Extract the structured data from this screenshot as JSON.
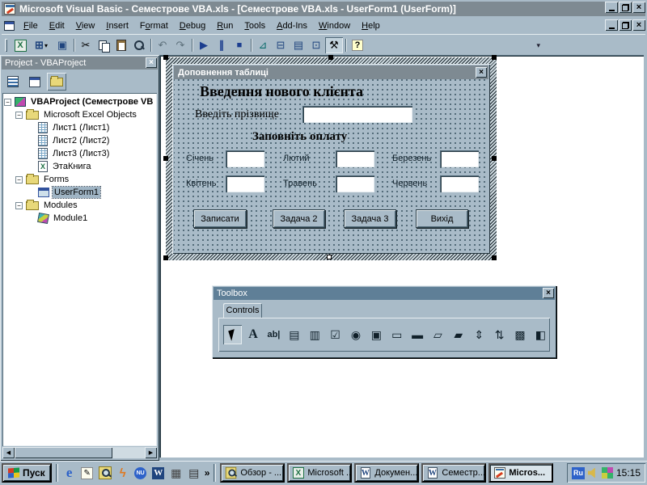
{
  "colors": {
    "window_face": "#a9bbc8",
    "title_bar": "#7e8a92",
    "toolbox_title_bar": "#5f7f97",
    "mdi_background": "#ffffff",
    "tree_selection": "#9fb4c4",
    "run_button_blue": "#1b3d8f",
    "excel_green": "#1e7145"
  },
  "titlebar": {
    "title": "Microsoft Visual Basic - Семестрове VBA.xls - [Семестрове VBA.xls - UserForm1 (UserForm)]"
  },
  "menubar": {
    "items": [
      {
        "label": "File"
      },
      {
        "label": "Edit"
      },
      {
        "label": "View"
      },
      {
        "label": "Insert"
      },
      {
        "label": "Format"
      },
      {
        "label": "Debug"
      },
      {
        "label": "Run"
      },
      {
        "label": "Tools"
      },
      {
        "label": "Add-Ins"
      },
      {
        "label": "Window"
      },
      {
        "label": "Help"
      }
    ]
  },
  "toolbar": {
    "icons": [
      {
        "name": "view-microsoft-excel",
        "glyph": "X"
      },
      {
        "name": "insert-userform",
        "glyph": "⊞"
      },
      {
        "name": "save",
        "glyph": "▣"
      },
      {
        "name": "cut",
        "glyph": "✂"
      },
      {
        "name": "copy",
        "glyph": ""
      },
      {
        "name": "paste",
        "glyph": ""
      },
      {
        "name": "find",
        "glyph": ""
      },
      {
        "name": "undo",
        "glyph": "↶"
      },
      {
        "name": "redo",
        "glyph": "↷"
      },
      {
        "name": "run-sub",
        "glyph": "▶"
      },
      {
        "name": "break",
        "glyph": "∥"
      },
      {
        "name": "reset",
        "glyph": "■"
      },
      {
        "name": "design-mode",
        "glyph": "⊿"
      },
      {
        "name": "project-explorer",
        "glyph": "⊟"
      },
      {
        "name": "properties-window",
        "glyph": "▤"
      },
      {
        "name": "object-browser",
        "glyph": "⊡"
      },
      {
        "name": "toolbox",
        "glyph": "⚒"
      },
      {
        "name": "help",
        "glyph": "?"
      }
    ]
  },
  "project_panel": {
    "title": "Project - VBAProject",
    "tree": [
      {
        "label": "VBAProject (Семестрове VB",
        "icon": "project"
      },
      {
        "label": "Microsoft Excel Objects",
        "icon": "folder"
      },
      {
        "label": "Лист1 (Лист1)",
        "icon": "worksheet"
      },
      {
        "label": "Лист2 (Лист2)",
        "icon": "worksheet"
      },
      {
        "label": "Лист3 (Лист3)",
        "icon": "worksheet"
      },
      {
        "label": "ЭтаКнига",
        "icon": "workbook"
      },
      {
        "label": "Forms",
        "icon": "folder"
      },
      {
        "label": "UserForm1",
        "icon": "userform"
      },
      {
        "label": "Modules",
        "icon": "folder"
      },
      {
        "label": "Module1",
        "icon": "module"
      }
    ]
  },
  "form_designer": {
    "title": "Доповнення таблиці",
    "heading": "Введення нового клієнта",
    "surname_label": "Введіть прізвище",
    "surname_value": "",
    "payment_heading": "Заповніть оплату",
    "months": [
      "Січень",
      "Лютий",
      "Березень",
      "Квітень",
      "Травень",
      "Червень"
    ],
    "month_values": [
      "",
      "",
      "",
      "",
      "",
      ""
    ],
    "buttons": [
      "Записати",
      "Задача 2",
      "Задача 3",
      "Вихід"
    ]
  },
  "toolbox": {
    "title": "Toolbox",
    "tab": "Controls",
    "tools": [
      {
        "name": "select-objects",
        "glyph": ""
      },
      {
        "name": "label",
        "glyph": "A"
      },
      {
        "name": "textbox",
        "glyph": "ab|"
      },
      {
        "name": "combobox",
        "glyph": "▤"
      },
      {
        "name": "listbox",
        "glyph": "▥"
      },
      {
        "name": "checkbox",
        "glyph": "☑"
      },
      {
        "name": "optionbutton",
        "glyph": "◉"
      },
      {
        "name": "togglebutton",
        "glyph": "▣"
      },
      {
        "name": "frame",
        "glyph": "▭"
      },
      {
        "name": "commandbutton",
        "glyph": "▬"
      },
      {
        "name": "tabstrip",
        "glyph": "▱"
      },
      {
        "name": "multipage",
        "glyph": "▰"
      },
      {
        "name": "scrollbar",
        "glyph": "⇕"
      },
      {
        "name": "spinbutton",
        "glyph": "⇅"
      },
      {
        "name": "image",
        "glyph": "▩"
      },
      {
        "name": "refedit",
        "glyph": "◧"
      }
    ]
  },
  "taskbar": {
    "start_label": "Пуск",
    "quick_launch": [
      {
        "name": "internet-explorer",
        "glyph": "e"
      },
      {
        "name": "notes",
        "glyph": "✎"
      },
      {
        "name": "find-folder",
        "glyph": ""
      },
      {
        "name": "winamp",
        "glyph": "ϟ"
      },
      {
        "name": "norton-utilities",
        "glyph": "NU"
      },
      {
        "name": "word",
        "glyph": "W"
      },
      {
        "name": "calculator",
        "glyph": "▦"
      },
      {
        "name": "printer",
        "glyph": "▤"
      },
      {
        "name": "more",
        "glyph": "»"
      }
    ],
    "tasks": [
      {
        "label": "Обзор - ...",
        "icon": "folder-search",
        "active": false
      },
      {
        "label": "Microsoft ...",
        "icon": "excel",
        "active": false
      },
      {
        "label": "Докумен...",
        "icon": "word",
        "active": false
      },
      {
        "label": "Семестр...",
        "icon": "word",
        "active": false
      },
      {
        "label": "Micros...",
        "icon": "visual-basic",
        "active": true
      }
    ],
    "tray": {
      "language": "Ru",
      "time": "15:15"
    }
  }
}
